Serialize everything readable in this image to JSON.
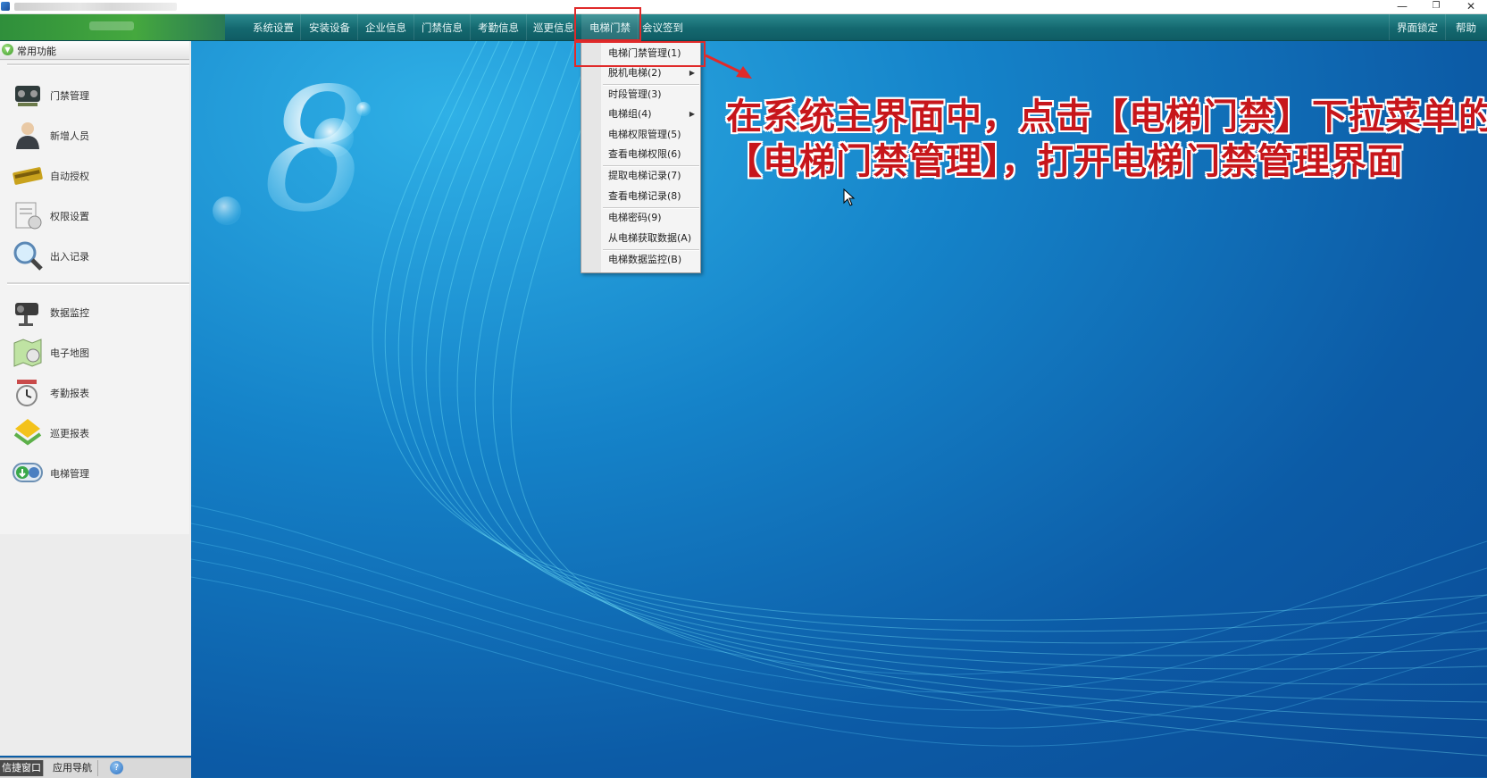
{
  "window": {
    "controls": {
      "minimize": "—",
      "restore": "❐",
      "close": "✕"
    }
  },
  "menubar": {
    "items": [
      "系统设置",
      "安装设备",
      "企业信息",
      "门禁信息",
      "考勤信息",
      "巡更信息",
      "电梯门禁",
      "会议签到"
    ],
    "active": "电梯门禁",
    "right_items": [
      "界面锁定",
      "帮助"
    ]
  },
  "sidebar": {
    "header": "常用功能",
    "group1": [
      {
        "label": "门禁管理",
        "icon": "door-controller-icon"
      },
      {
        "label": "新增人员",
        "icon": "person-icon"
      },
      {
        "label": "自动授权",
        "icon": "card-icon"
      },
      {
        "label": "权限设置",
        "icon": "permission-icon"
      },
      {
        "label": "出入记录",
        "icon": "magnifier-icon"
      }
    ],
    "group2": [
      {
        "label": "数据监控",
        "icon": "camera-icon"
      },
      {
        "label": "电子地图",
        "icon": "map-icon"
      },
      {
        "label": "考勤报表",
        "icon": "clock-icon"
      },
      {
        "label": "巡更报表",
        "icon": "patrol-icon"
      },
      {
        "label": "电梯管理",
        "icon": "elevator-icon"
      }
    ]
  },
  "bottom_tabs": {
    "tab1": "信捷窗口",
    "tab2": "应用导航",
    "help": "?"
  },
  "dropdown": {
    "items": [
      {
        "label": "电梯门禁管理(1)",
        "submenu": false
      },
      {
        "label": "脱机电梯(2)",
        "submenu": true
      },
      {
        "label": "时段管理(3)",
        "submenu": false
      },
      {
        "label": "电梯组(4)",
        "submenu": true
      },
      {
        "label": "电梯权限管理(5)",
        "submenu": false
      },
      {
        "label": "查看电梯权限(6)",
        "submenu": false
      },
      {
        "label": "提取电梯记录(7)",
        "submenu": false
      },
      {
        "label": "查看电梯记录(8)",
        "submenu": false
      },
      {
        "label": "电梯密码(9)",
        "submenu": false
      },
      {
        "label": "从电梯获取数据(A)",
        "submenu": false
      },
      {
        "label": "电梯数据监控(B)",
        "submenu": false
      }
    ]
  },
  "annotation": {
    "line1": "在系统主界面中，点击【电梯门禁】下拉菜单的",
    "line2": "【电梯门禁管理】，打开电梯门禁管理界面",
    "color": "#c7161b"
  },
  "colors": {
    "highlight_box": "#e02a2a",
    "menubar": "#14686f",
    "desktop": "#0c5ba6"
  }
}
